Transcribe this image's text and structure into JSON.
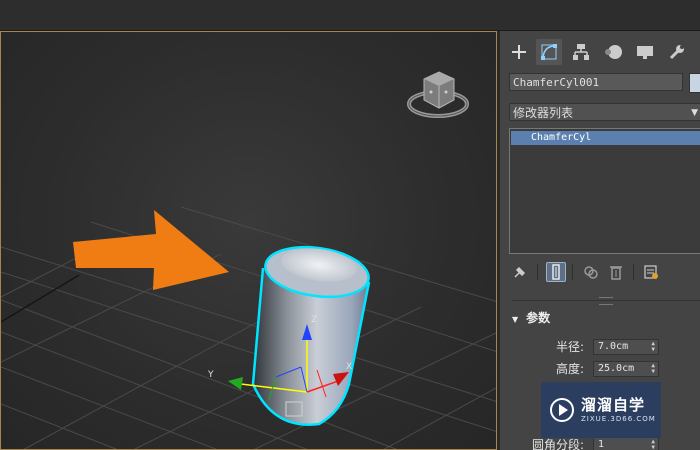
{
  "command_panel": {
    "tabs": [
      {
        "name": "create-tab",
        "icon": "plus-icon"
      },
      {
        "name": "modify-tab",
        "icon": "modify-curve-icon",
        "active": true
      },
      {
        "name": "hierarchy-tab",
        "icon": "hierarchy-icon"
      },
      {
        "name": "motion-tab",
        "icon": "motion-icon"
      },
      {
        "name": "display-tab",
        "icon": "display-icon"
      },
      {
        "name": "utilities-tab",
        "icon": "wrench-icon"
      }
    ],
    "object_name": "ChamferCyl001",
    "object_color": "#c9d4e2",
    "modifier_list_label": "修改器列表",
    "stack_items": [
      "ChamferCyl"
    ],
    "stack_tools": [
      "pin-stack-icon",
      "show-end-result-icon",
      "make-unique-icon",
      "remove-modifier-icon",
      "configure-modifier-sets-icon"
    ],
    "rollout": {
      "title": "参数",
      "params": [
        {
          "label": "半径:",
          "value": "7.0cm"
        },
        {
          "label": "高度:",
          "value": "25.0cm"
        },
        {
          "label": "圆角分段:",
          "value": "1"
        }
      ]
    }
  },
  "viewport": {
    "gizmo_axes": {
      "x": "X",
      "y": "Y",
      "z": "Z"
    },
    "selection_color": "#00e5ff",
    "arrow_color": "#f07d14",
    "border_color": "#a8844a"
  },
  "watermark": {
    "title": "溜溜自学",
    "subtitle": "ZIXUE.3D66.COM"
  }
}
